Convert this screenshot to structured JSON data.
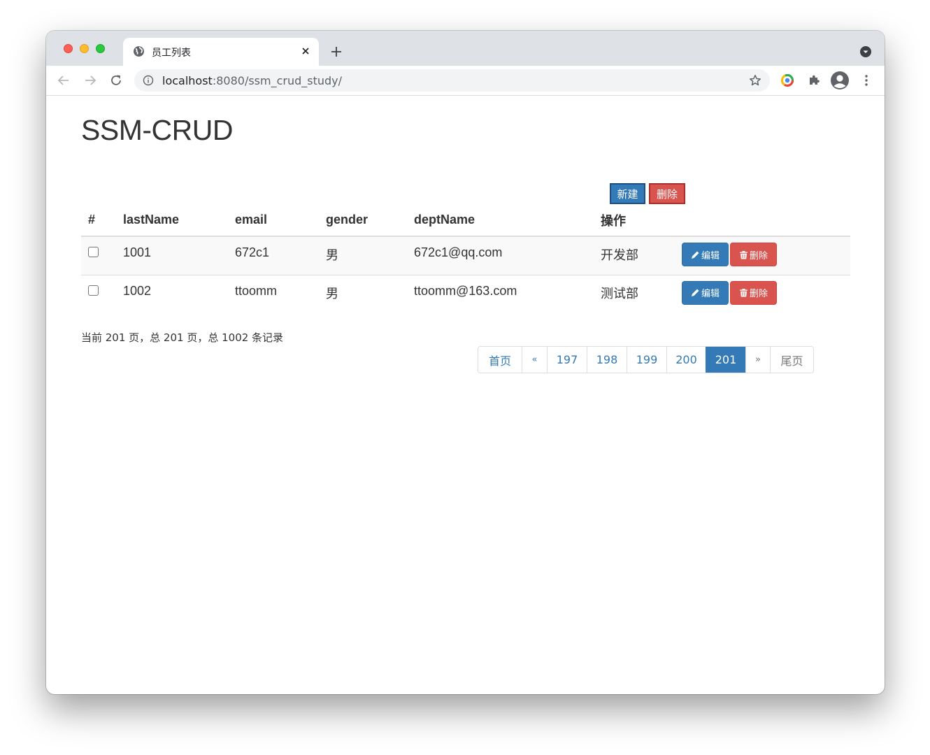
{
  "browser": {
    "tab_title": "员工列表",
    "url_host": "localhost",
    "url_path": ":8080/ssm_crud_study/"
  },
  "page": {
    "title": "SSM-CRUD",
    "new_button": "新建",
    "delete_button": "删除"
  },
  "table": {
    "headers": [
      "#",
      "lastName",
      "email",
      "gender",
      "deptName",
      "操作"
    ],
    "rows": [
      {
        "id": "1001",
        "lastName": "672c1",
        "gender": "男",
        "email": "672c1@qq.com",
        "dept": "开发部"
      },
      {
        "id": "1002",
        "lastName": "ttoomm",
        "gender": "男",
        "email": "ttoomm@163.com",
        "dept": "测试部"
      }
    ],
    "edit_label": "编辑",
    "delete_label": "删除"
  },
  "pagination": {
    "info": "当前 201 页，总 201 页，总 1002 条记录",
    "first": "首页",
    "prev": "«",
    "pages": [
      "197",
      "198",
      "199",
      "200",
      "201"
    ],
    "current": "201",
    "next": "»",
    "last": "尾页"
  },
  "colors": {
    "primary": "#337ab7",
    "danger": "#d9534f"
  }
}
